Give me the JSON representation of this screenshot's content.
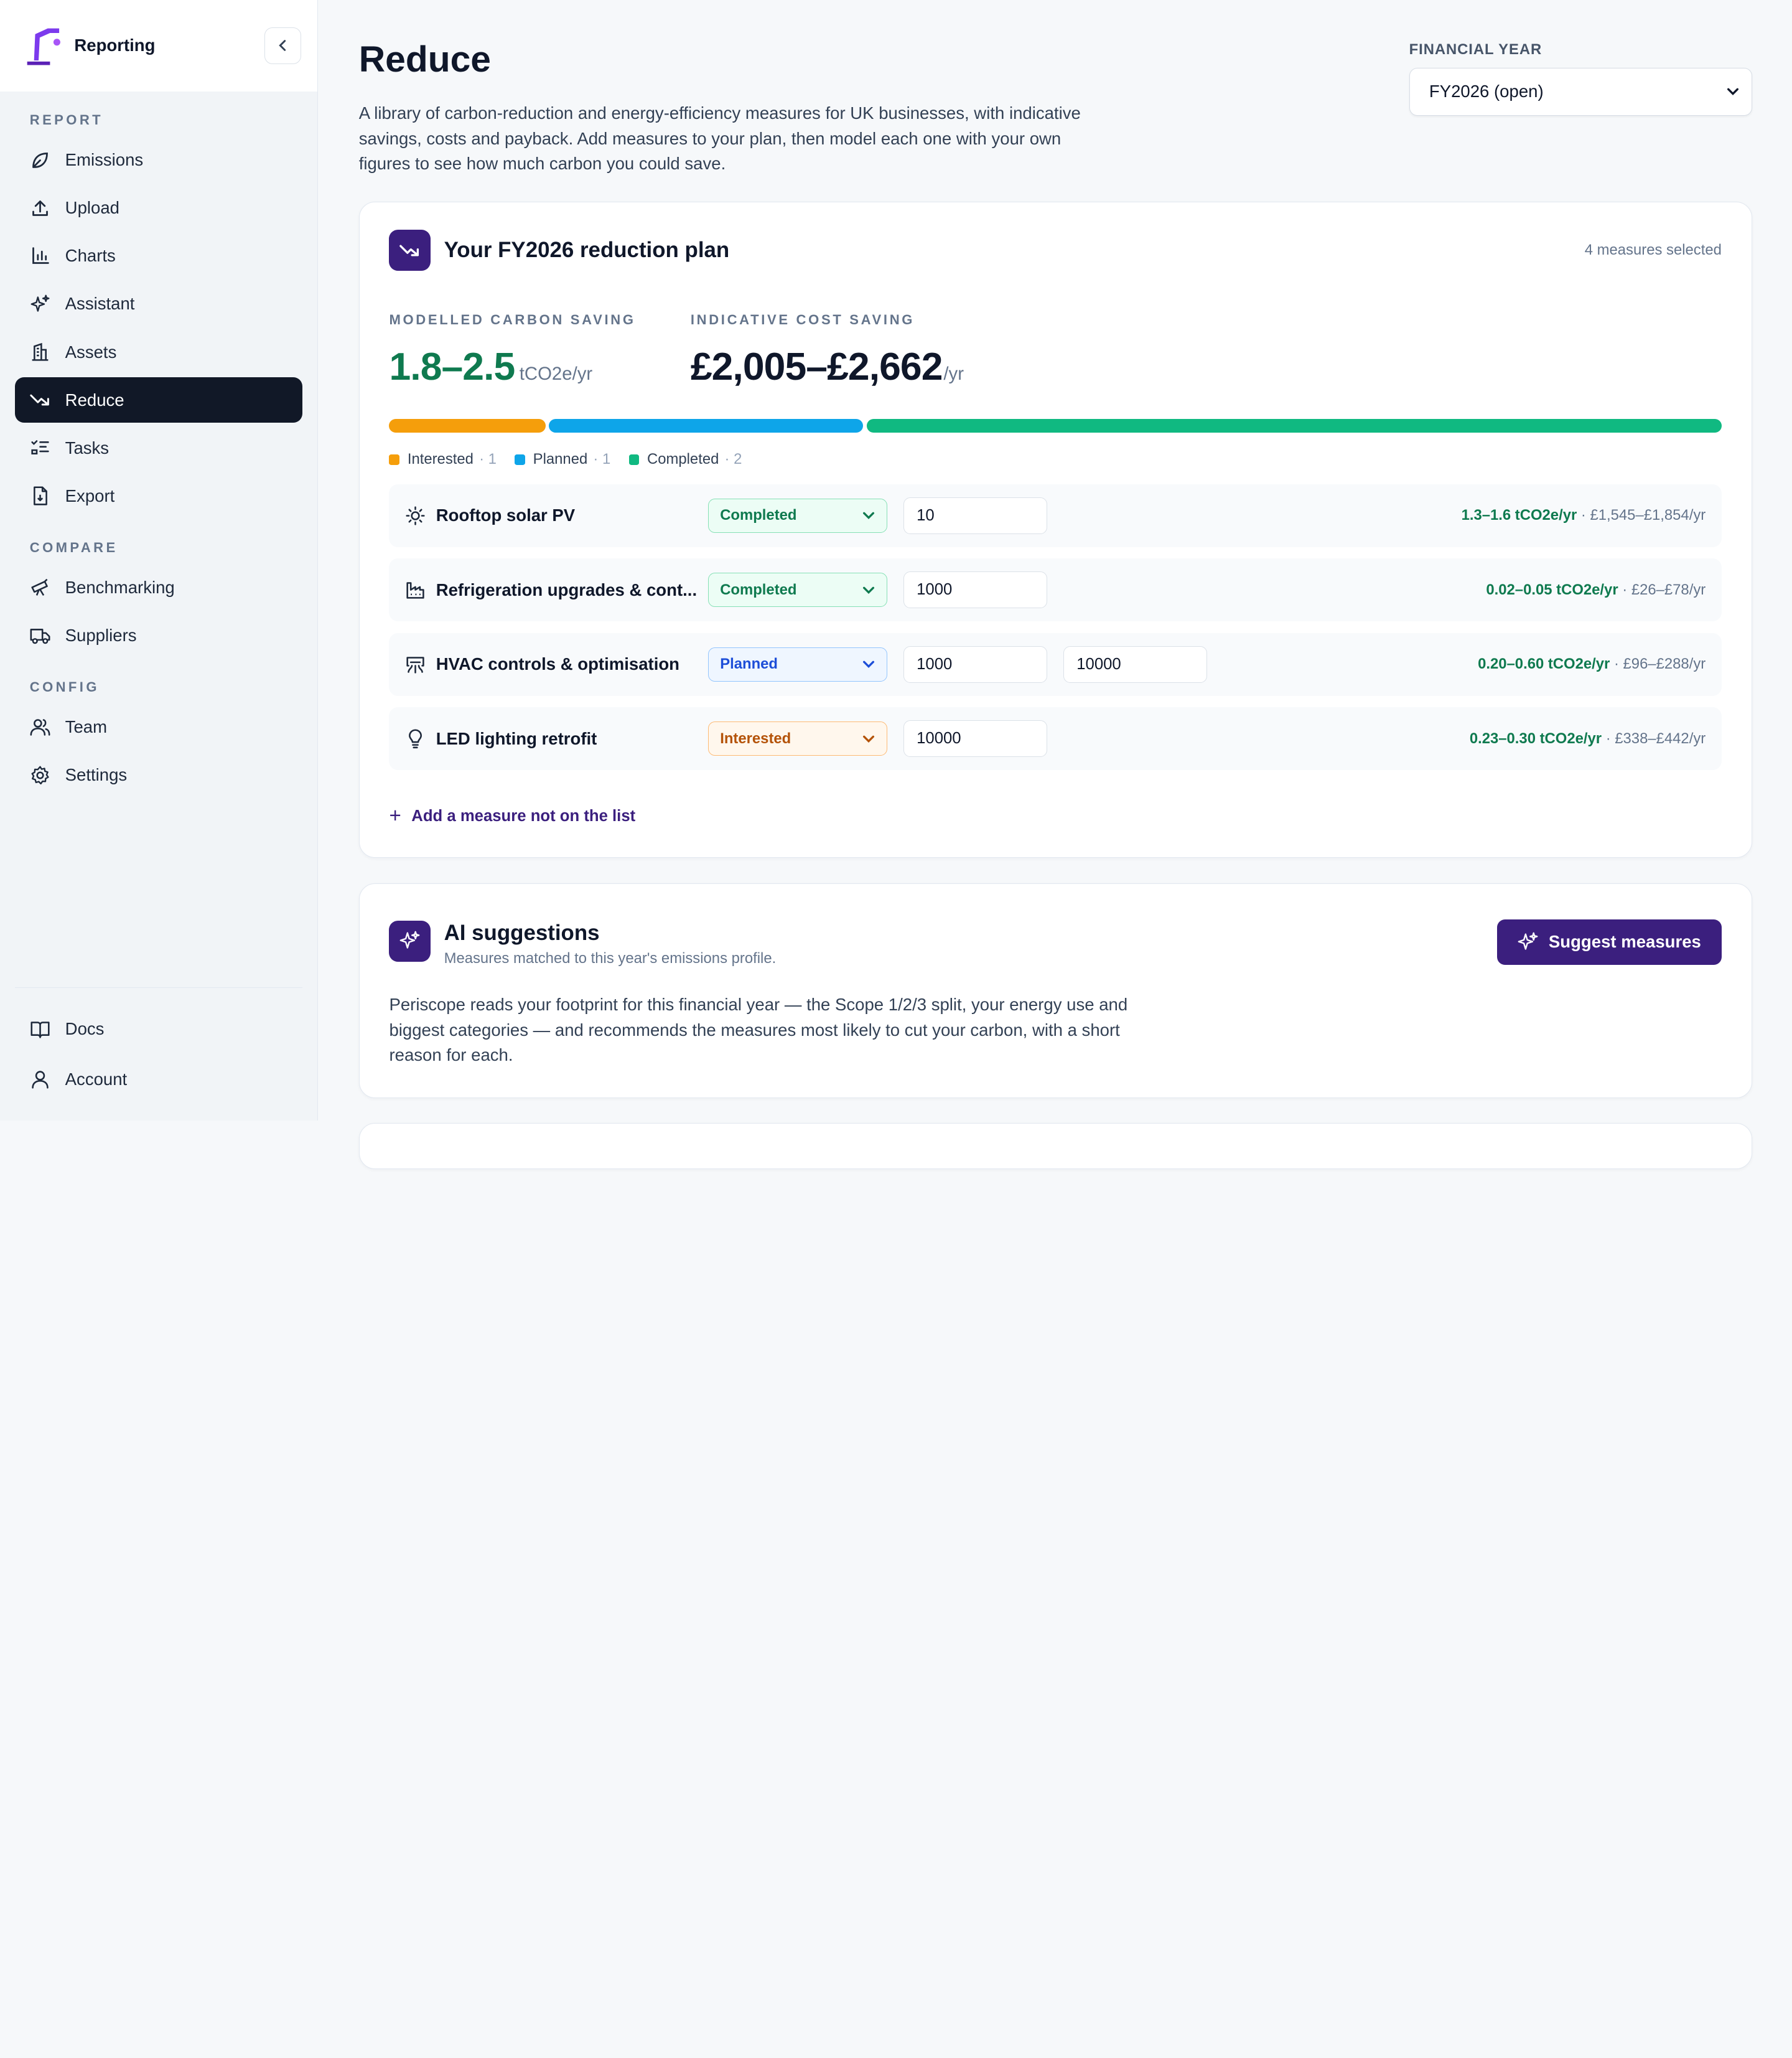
{
  "brand": {
    "name": "Reporting"
  },
  "sidebar": {
    "sections": [
      {
        "label": "REPORT",
        "items": [
          {
            "label": "Emissions",
            "icon": "leaf-icon"
          },
          {
            "label": "Upload",
            "icon": "upload-icon"
          },
          {
            "label": "Charts",
            "icon": "bar-chart-icon"
          },
          {
            "label": "Assistant",
            "icon": "sparkles-icon"
          },
          {
            "label": "Assets",
            "icon": "building-icon"
          },
          {
            "label": "Reduce",
            "icon": "trending-down-icon",
            "active": true
          },
          {
            "label": "Tasks",
            "icon": "checklist-icon"
          },
          {
            "label": "Export",
            "icon": "file-export-icon"
          }
        ]
      },
      {
        "label": "COMPARE",
        "items": [
          {
            "label": "Benchmarking",
            "icon": "telescope-icon"
          },
          {
            "label": "Suppliers",
            "icon": "truck-icon"
          }
        ]
      },
      {
        "label": "CONFIG",
        "items": [
          {
            "label": "Team",
            "icon": "users-icon"
          },
          {
            "label": "Settings",
            "icon": "gear-icon"
          }
        ]
      }
    ],
    "bottom": [
      {
        "label": "Docs",
        "icon": "book-icon"
      },
      {
        "label": "Account",
        "icon": "user-icon"
      }
    ]
  },
  "page": {
    "title": "Reduce",
    "description": "A library of carbon-reduction and energy-efficiency measures for UK businesses, with indicative savings, costs and payback. Add measures to your plan, then model each one with your own figures to see how much carbon you could save."
  },
  "financial_year": {
    "label": "FINANCIAL YEAR",
    "value": "FY2026 (open)"
  },
  "plan": {
    "title": "Your FY2026 reduction plan",
    "count": "4 measures selected",
    "carbon": {
      "label": "MODELLED CARBON SAVING",
      "value": "1.8–2.5",
      "unit": "tCO2e/yr"
    },
    "cost": {
      "label": "INDICATIVE COST SAVING",
      "value": "£2,005–£2,662",
      "unit": "/yr"
    },
    "progress": [
      {
        "status": "Interested",
        "count": 1,
        "fraction": 0.118,
        "color": "#f59e0b"
      },
      {
        "status": "Planned",
        "count": 1,
        "fraction": 0.237,
        "color": "#0ea5e9"
      },
      {
        "status": "Completed",
        "count": 2,
        "fraction": 0.645,
        "color": "#10b981"
      }
    ],
    "legend": [
      {
        "label": "Interested",
        "n": "· 1",
        "color": "#f59e0b"
      },
      {
        "label": "Planned",
        "n": "· 1",
        "color": "#0ea5e9"
      },
      {
        "label": "Completed",
        "n": "· 2",
        "color": "#10b981"
      }
    ],
    "measures": [
      {
        "name": "Rooftop solar PV",
        "icon": "sun-icon",
        "status": "Completed",
        "status_class": "completed",
        "inputs": [
          "10"
        ],
        "carbon": "1.3–1.6 tCO2e/yr",
        "cost": " · £1,545–£1,854/yr"
      },
      {
        "name": "Refrigeration upgrades & cont...",
        "icon": "factory-icon",
        "status": "Completed",
        "status_class": "completed",
        "inputs": [
          "1000"
        ],
        "carbon": "0.02–0.05 tCO2e/yr",
        "cost": " · £26–£78/yr"
      },
      {
        "name": "HVAC controls & optimisation",
        "icon": "air-vent-icon",
        "status": "Planned",
        "status_class": "planned",
        "inputs": [
          "1000",
          "10000"
        ],
        "carbon": "0.20–0.60 tCO2e/yr",
        "cost": " · £96–£288/yr"
      },
      {
        "name": "LED lighting retrofit",
        "icon": "lightbulb-icon",
        "status": "Interested",
        "status_class": "interested",
        "inputs": [
          "10000"
        ],
        "carbon": "0.23–0.30 tCO2e/yr",
        "cost": " · £338–£442/yr"
      }
    ],
    "add_label": "Add a measure not on the list"
  },
  "ai": {
    "title": "AI suggestions",
    "subtitle": "Measures matched to this year's emissions profile.",
    "button": "Suggest measures",
    "body": "Periscope reads your footprint for this financial year — the Scope 1/2/3 split, your energy use and biggest categories — and recommends the measures most likely to cut your carbon, with a short reason for each."
  }
}
